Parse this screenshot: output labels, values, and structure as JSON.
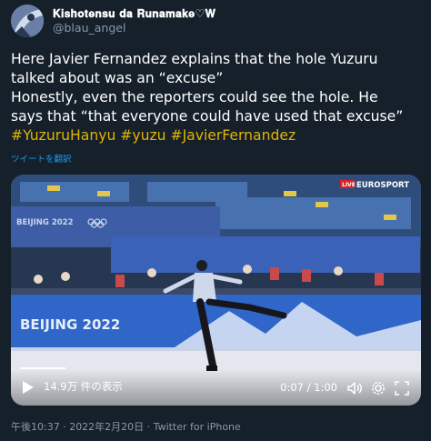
{
  "header": {
    "display_name": "𝐊𝐢𝐬𝐡𝐨𝐭𝐞𝐧𝐬𝐮 𝐝𝐚 𝐑𝐮𝐧𝐚𝐦𝐚𝐤𝐞♡𝐖",
    "handle": "@blau_angel"
  },
  "tweet": {
    "line1": "Here Javier Fernandez explains that the hole Yuzuru",
    "line2": "talked about was an “excuse”",
    "line3": "Honestly, even the reporters could see the hole. He",
    "line4": "says that “that everyone could have used that excuse”",
    "hashtags": [
      "#YuzuruHanyu",
      "#yuzu",
      "#JavierFernandez"
    ]
  },
  "translate_label": "ツイートを翻訳",
  "video": {
    "overlay_live": "LIVE",
    "overlay_brand": "EUROSPORT",
    "board_text_left": "BEIJING 2022",
    "board_text_main": "BEIJING 2022",
    "views": "14.9万 件の表示",
    "time": "0:07 / 1:00",
    "progress_fraction": 0.117
  },
  "meta": {
    "timestamp": "午後10:37 · 2022年2月20日 · Twitter for iPhone"
  },
  "colors": {
    "background": "#15202b",
    "hashtag": "#e0b400",
    "link": "#1d9bf0",
    "muted": "#8899a6"
  }
}
